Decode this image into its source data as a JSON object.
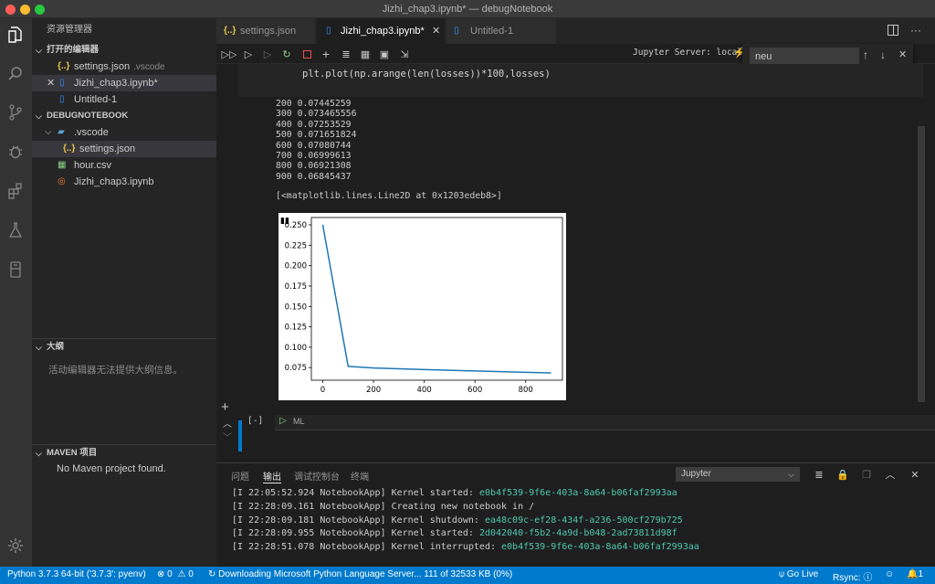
{
  "window": {
    "title": "Jizhi_chap3.ipynb* — debugNotebook",
    "colors": {
      "close": "#ff5f57",
      "minimize": "#febc2e",
      "maximize": "#28c840",
      "accent": "#007acc"
    }
  },
  "activity_icons": [
    "files-icon",
    "search-icon",
    "source-control-icon",
    "debug-icon",
    "extensions-icon",
    "testing-icon",
    "remote-icon",
    "gear-icon"
  ],
  "sidebar": {
    "title": "资源管理器",
    "open_editors": {
      "header": "打开的编辑器",
      "items": [
        {
          "icon": "json-icon",
          "label": "settings.json",
          "desc": ".vscode"
        },
        {
          "icon": "notebook-icon",
          "label": "Jizhi_chap3.ipynb*",
          "desc": ""
        },
        {
          "icon": "notebook-icon",
          "label": "Untitled-1",
          "desc": ""
        }
      ]
    },
    "project": {
      "header": "DEBUGNOTEBOOK",
      "items": [
        {
          "icon": "folder-icon",
          "label": ".vscode"
        },
        {
          "icon": "json-icon",
          "label": "settings.json"
        },
        {
          "icon": "csv-icon",
          "label": "hour.csv"
        },
        {
          "icon": "jupyter-icon",
          "label": "Jizhi_chap3.ipynb"
        }
      ]
    },
    "outline": {
      "header": "大纲",
      "message": "活动编辑器无法提供大纲信息。"
    },
    "maven": {
      "header": "MAVEN 项目",
      "message": "No Maven project found."
    }
  },
  "tabs": [
    {
      "label": "settings.json",
      "icon": "json-icon"
    },
    {
      "label": "Jizhi_chap3.ipynb*",
      "icon": "notebook-icon",
      "active": true
    },
    {
      "label": "Untitled-1",
      "icon": "notebook-icon"
    }
  ],
  "toolbar": {
    "server_label": "Jupyter Server: local"
  },
  "find": {
    "value": "neu"
  },
  "notebook": {
    "code": "plt.plot(np.arange(len(losses))*100,losses)",
    "output_lines": [
      "200 0.07445259",
      "300 0.073465556",
      "400 0.07253529",
      "500 0.071651824",
      "600 0.07080744",
      "700 0.06999613",
      "800 0.06921308",
      "900 0.06845437"
    ],
    "output_repr": "[<matplotlib.lines.Line2D at 0x1203edeb8>]",
    "md_cell_marker": "[-]",
    "md_cell_label": "ML"
  },
  "chart_data": {
    "type": "line",
    "title": "",
    "xlabel": "",
    "ylabel": "",
    "x": [
      0,
      100,
      200,
      300,
      400,
      500,
      600,
      700,
      800,
      900
    ],
    "series": [
      {
        "values": [
          0.25,
          0.0765,
          0.07445259,
          0.073465556,
          0.07253529,
          0.071651824,
          0.07080744,
          0.06999613,
          0.06921308,
          0.06845437
        ],
        "color": "#1f77b4"
      }
    ],
    "xticks": [
      "0",
      "200",
      "400",
      "600",
      "800"
    ],
    "yticks": [
      "0.075",
      "0.100",
      "0.125",
      "0.150",
      "0.175",
      "0.200",
      "0.225",
      "0.250"
    ],
    "xlim": [
      -45,
      945
    ],
    "ylim": [
      0.0595,
      0.259
    ],
    "grid": false
  },
  "panel": {
    "tabs": [
      "问题",
      "输出",
      "调试控制台",
      "终端"
    ],
    "active_tab": "输出",
    "channel": "Jupyter",
    "logs": [
      {
        "prefix": "[I 22:05:52.924 NotebookApp] Kernel started: ",
        "id": "e0b4f539-9f6e-403a-8a64-b06faf2993aa"
      },
      {
        "prefix": "[I 22:28:09.161 NotebookApp] Creating new notebook in /",
        "id": ""
      },
      {
        "prefix": "[I 22:28:09.181 NotebookApp] Kernel shutdown: ",
        "id": "ea48c09c-ef28-434f-a236-500cf279b725"
      },
      {
        "prefix": "[I 22:28:09.955 NotebookApp] Kernel started: ",
        "id": "2d042040-f5b2-4a9d-b048-2ad73811d98f"
      },
      {
        "prefix": "[I 22:28:51.078 NotebookApp] Kernel interrupted: ",
        "id": "e0b4f539-9f6e-403a-8a64-b06faf2993aa"
      }
    ]
  },
  "status": {
    "python": "Python 3.7.3 64-bit ('3.7.3': pyenv)",
    "errors": "0",
    "warnings": "0",
    "download": "Downloading Microsoft Python Language Server... 111 of 32533 KB (0%)",
    "golive": "Go Live",
    "rsync": "Rsync:",
    "notifications": "1"
  }
}
